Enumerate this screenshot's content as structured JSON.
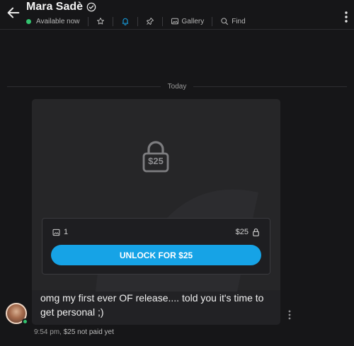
{
  "header": {
    "title": "Mara Sadè",
    "status": "Available now",
    "gallery_label": "Gallery",
    "find_label": "Find",
    "accent_color": "#16a3e6",
    "online_color": "#33c36f"
  },
  "divider": {
    "label": "Today"
  },
  "message": {
    "locked_price": "$25",
    "media_count": "1",
    "price": "$25",
    "unlock_label": "UNLOCK FOR $25",
    "text": "omg my first ever OF release.... told you it's time to get personal ;)",
    "time": "9:54 pm,",
    "payment_status": "$25 not paid yet"
  },
  "icons": {
    "back": "arrow-left-icon",
    "verified": "verified-check-icon",
    "star": "star-icon",
    "bell": "bell-icon",
    "pin": "pin-icon",
    "gallery": "image-icon",
    "find": "search-icon",
    "more": "more-vertical-icon",
    "lock": "lock-icon"
  }
}
